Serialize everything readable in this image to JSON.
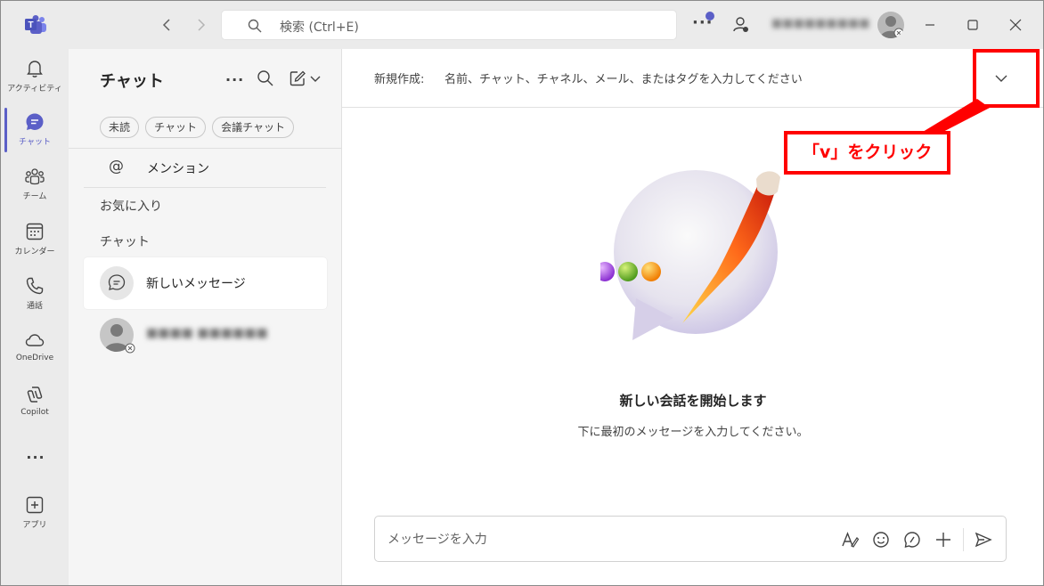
{
  "titlebar": {
    "search_placeholder": "検索 (Ctrl+E)",
    "user_name": "■■■■■■■■■",
    "back_icon": "chevron-left-icon",
    "forward_icon": "chevron-right-icon",
    "min_icon": "minimize-icon",
    "max_icon": "maximize-icon",
    "close_icon": "close-icon"
  },
  "rail": {
    "items": [
      {
        "label": "アクティビティ",
        "icon": "bell-icon"
      },
      {
        "label": "チャット",
        "icon": "chat-icon"
      },
      {
        "label": "チーム",
        "icon": "teams-icon"
      },
      {
        "label": "カレンダー",
        "icon": "calendar-icon"
      },
      {
        "label": "通話",
        "icon": "phone-icon"
      },
      {
        "label": "OneDrive",
        "icon": "cloud-icon"
      },
      {
        "label": "Copilot",
        "icon": "copilot-icon"
      },
      {
        "label": "アプリ",
        "icon": "plus-square-icon"
      }
    ],
    "more": "..."
  },
  "chatlist": {
    "title": "チャット",
    "more": "...",
    "filters": [
      "未読",
      "チャット",
      "会議チャット"
    ],
    "mentions": "メンション",
    "favorites": "お気に入り",
    "chats_section": "チャット",
    "items": [
      {
        "name": "新しいメッセージ",
        "selected": true
      },
      {
        "name": "■■■■ ■■■■■■",
        "selected": false
      }
    ]
  },
  "main": {
    "to_label": "新規作成:",
    "to_placeholder": "名前、チャット、チャネル、メール、またはタグを入力してください",
    "empty_title": "新しい会話を開始します",
    "empty_subtitle": "下に最初のメッセージを入力してください。",
    "compose_placeholder": "メッセージを入力"
  },
  "annotation": {
    "label": "「v」をクリック",
    "color": "#ff0000"
  },
  "colors": {
    "brand": "#5b5fc7",
    "annotation": "#ff0000"
  }
}
